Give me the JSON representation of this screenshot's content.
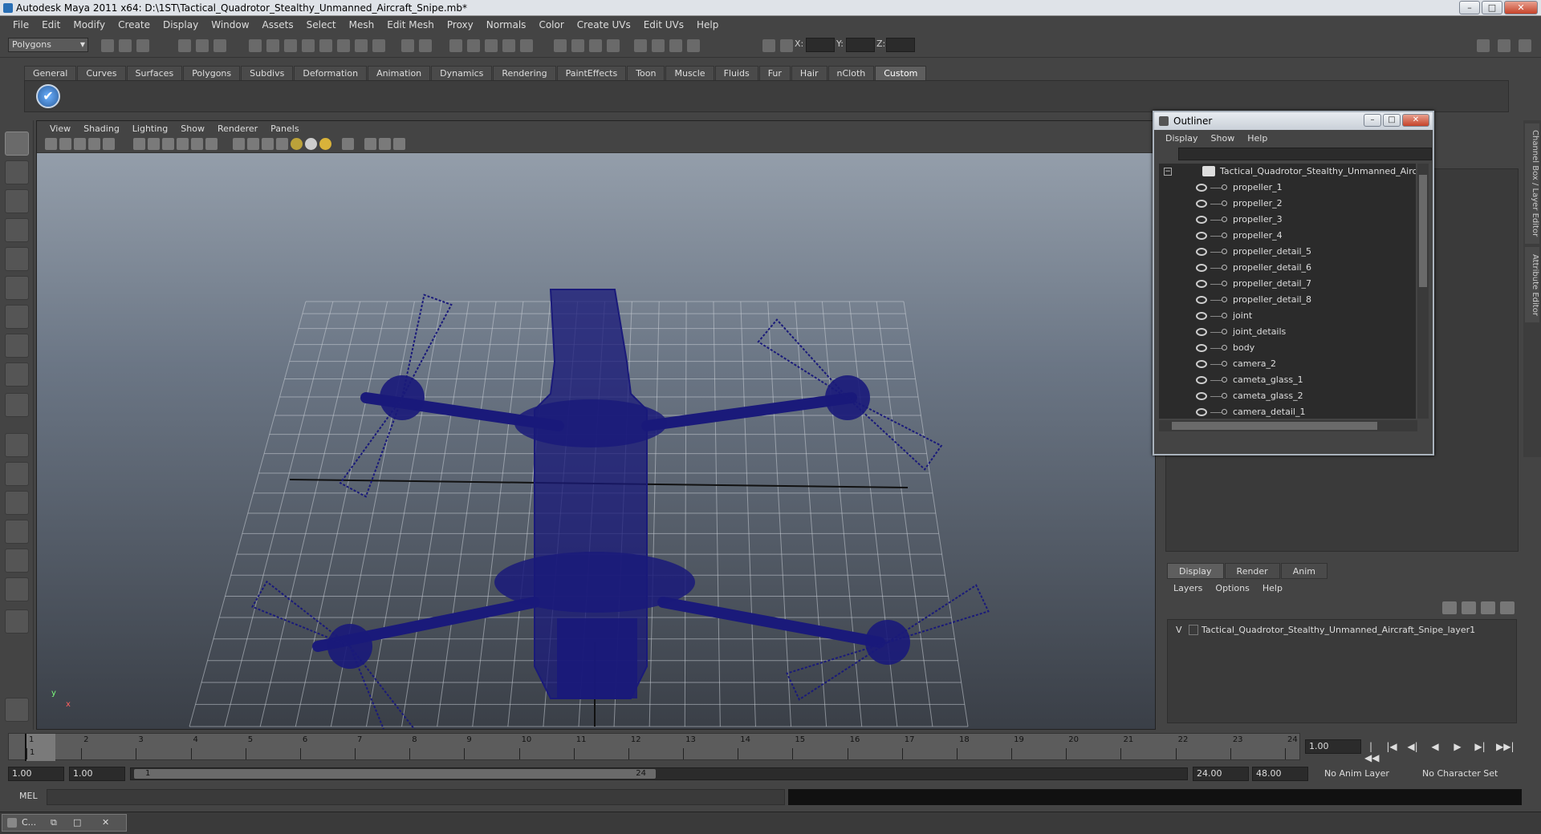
{
  "window": {
    "title": "Autodesk Maya 2011 x64: D:\\1ST\\Tactical_Quadrotor_Stealthy_Unmanned_Aircraft_Snipe.mb*",
    "min": "–",
    "max": "□",
    "close": "✕"
  },
  "menubar": [
    "File",
    "Edit",
    "Modify",
    "Create",
    "Display",
    "Window",
    "Assets",
    "Select",
    "Mesh",
    "Edit Mesh",
    "Proxy",
    "Normals",
    "Color",
    "Create UVs",
    "Edit UVs",
    "Help"
  ],
  "status": {
    "mode": "Polygons",
    "x_label": "X:",
    "y_label": "Y:",
    "z_label": "Z:"
  },
  "shelf_tabs": [
    "General",
    "Curves",
    "Surfaces",
    "Polygons",
    "Subdivs",
    "Deformation",
    "Animation",
    "Dynamics",
    "Rendering",
    "PaintEffects",
    "Toon",
    "Muscle",
    "Fluids",
    "Fur",
    "Hair",
    "nCloth",
    "Custom"
  ],
  "shelf_active": "Custom",
  "shelf_icon_glyph": "✔",
  "viewport": {
    "menu": [
      "View",
      "Shading",
      "Lighting",
      "Show",
      "Renderer",
      "Panels"
    ],
    "axis_y": "y",
    "axis_x": "x",
    "wire_color": "#1a1a7a"
  },
  "outliner": {
    "title": "Outliner",
    "menu": [
      "Display",
      "Show",
      "Help"
    ],
    "root": "Tactical_Quadrotor_Stealthy_Unmanned_Aircraft_S",
    "expand": "−",
    "items": [
      "propeller_1",
      "propeller_2",
      "propeller_3",
      "propeller_4",
      "propeller_detail_5",
      "propeller_detail_6",
      "propeller_detail_7",
      "propeller_detail_8",
      "joint",
      "joint_details",
      "body",
      "camera_2",
      "cameta_glass_1",
      "cameta_glass_2",
      "camera_detail_1"
    ],
    "min": "–",
    "max": "□",
    "close": "✕"
  },
  "side_tabs": [
    "Channel Box / Layer Editor",
    "Attribute Editor"
  ],
  "layers": {
    "tabs": [
      "Display",
      "Render",
      "Anim"
    ],
    "menu": [
      "Layers",
      "Options",
      "Help"
    ],
    "row_visible": "V",
    "row_name": "Tactical_Quadrotor_Stealthy_Unmanned_Aircraft_Snipe_layer1"
  },
  "timeline": {
    "ticks": [
      "1",
      "2",
      "3",
      "4",
      "5",
      "6",
      "7",
      "8",
      "9",
      "10",
      "11",
      "12",
      "13",
      "14",
      "15",
      "16",
      "17",
      "18",
      "19",
      "20",
      "21",
      "22",
      "23",
      "24"
    ],
    "current": "1",
    "current_time": "1.00",
    "controls": [
      "|◀◀",
      "|◀",
      "◀|",
      "◀",
      "▶",
      "▶|",
      "▶▶|"
    ]
  },
  "range": {
    "start": "1.00",
    "play_start": "1.00",
    "thumb_start": "1",
    "thumb_end": "24",
    "play_end": "24.00",
    "end": "48.00",
    "anim_layer": "No Anim Layer",
    "char_set": "No Character Set"
  },
  "cmd": {
    "label": "MEL"
  },
  "taskbar": {
    "item": "C...",
    "b1": "⧉",
    "b2": "□",
    "b3": "✕"
  }
}
